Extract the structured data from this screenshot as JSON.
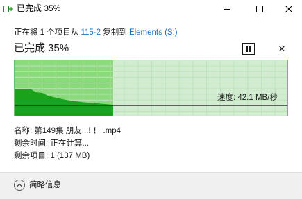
{
  "window": {
    "title": "已完成 35%",
    "app_icon": "copy-progress-icon",
    "minimize_icon": "minimize-icon",
    "maximize_icon": "maximize-icon",
    "close_icon": "close-icon"
  },
  "copy": {
    "prefix": "正在将 1 个项目从 ",
    "source": "115-2",
    "middle": " 复制到 ",
    "destination": "Elements (S:)"
  },
  "progress": {
    "status": "已完成 35%",
    "percent": 35,
    "pause_icon": "pause-icon",
    "cancel_icon": "cancel-icon",
    "cancel_glyph": "✕",
    "speed_label": "速度: 42.1 MB/秒",
    "colors": {
      "done_fill": "#8ad97a",
      "remaining_fill": "#d1ecd0",
      "speed_area": "#1aa31a",
      "speed_line": "#1a1a1a",
      "border": "#6fbf6f"
    }
  },
  "details": {
    "name": "名称: 第149集 朋友...! ！ .mp4",
    "time_remaining": "剩余时间: 正在计算...",
    "items_remaining": "剩余项目: 1 (137 MB)"
  },
  "footer": {
    "toggle_icon": "chevron-up-icon",
    "label": "简略信息"
  }
}
